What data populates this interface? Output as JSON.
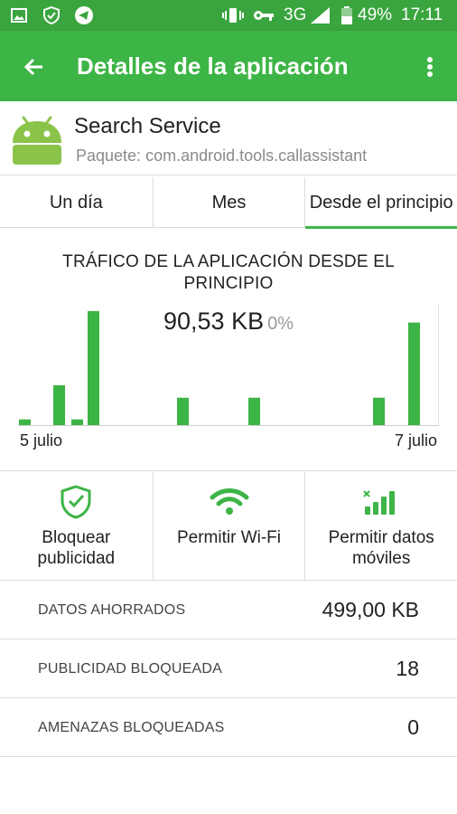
{
  "status_bar": {
    "network": "3G",
    "battery": "49%",
    "time": "17:11"
  },
  "app_bar": {
    "title": "Detalles de la aplicación"
  },
  "app": {
    "name": "Search Service",
    "package": "Paquete: com.android.tools.callassistant"
  },
  "tabs": [
    {
      "label": "Un día",
      "active": false
    },
    {
      "label": "Mes",
      "active": false
    },
    {
      "label": "Desde el principio",
      "active": true
    }
  ],
  "chart_data": {
    "type": "bar",
    "title": "TRÁFICO DE LA APLICACIÓN DESDE EL PRINCIPIO",
    "total": "90,53 KB",
    "percent": "0%",
    "x_start_label": "5 julio",
    "x_end_label": "7 julio",
    "values": [
      0.05,
      0.35,
      0.05,
      1.0,
      0.24,
      0.24,
      0.24,
      0.9
    ],
    "series_color": "#3db446"
  },
  "actions": [
    {
      "label": "Bloquear publicidad",
      "icon": "shield-check-icon"
    },
    {
      "label": "Permitir Wi-Fi",
      "icon": "wifi-icon"
    },
    {
      "label": "Permitir datos móviles",
      "icon": "mobile-signal-icon"
    }
  ],
  "stats": [
    {
      "label": "DATOS AHORRADOS",
      "value": "499,00 KB"
    },
    {
      "label": "PUBLICIDAD BLOQUEADA",
      "value": "18"
    },
    {
      "label": "AMENAZAS BLOQUEADAS",
      "value": "0"
    }
  ],
  "colors": {
    "status_bar": "#3aa53f",
    "app_bar": "#3db446",
    "accent": "#3db446"
  }
}
